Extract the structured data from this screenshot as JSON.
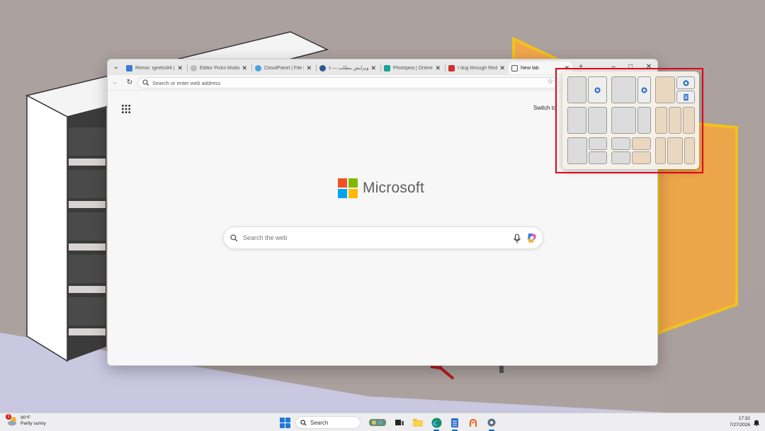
{
  "browser": {
    "tabs": [
      {
        "title": "Remix: igeeks84 | ",
        "favicon_color": "#3a7bd5",
        "active": false
      },
      {
        "title": "Editor Picks Modul",
        "favicon_color": "#999999",
        "active": false
      },
      {
        "title": "CloudPanel | File M",
        "favicon_color": "#4aa3df",
        "active": false
      },
      {
        "title": "ویرایش مطلب — ro",
        "favicon_color": "#2b5797",
        "active": false
      },
      {
        "title": "Photopea | Online I",
        "favicon_color": "#18a497",
        "active": false
      },
      {
        "title": "I dug through Redd",
        "favicon_color": "#d32f2f",
        "active": false
      },
      {
        "title": "New tab",
        "favicon_color": "#555555",
        "active": true
      }
    ],
    "address": {
      "placeholder": "Search or enter web address",
      "value": ""
    },
    "page": {
      "switch_to": "Switch to",
      "brand": "Microsoft",
      "search_placeholder": "Search the web"
    }
  },
  "snap_layouts": {
    "layouts": [
      {
        "name": "halves",
        "icons": [
          "gear-icon"
        ]
      },
      {
        "name": "two-thirds-one-third",
        "icons": [
          "gear-icon"
        ]
      },
      {
        "name": "one-and-stack",
        "icons": [
          "gear-icon",
          "notepad-icon"
        ]
      },
      {
        "name": "halves-2"
      },
      {
        "name": "large-small"
      },
      {
        "name": "three-columns"
      },
      {
        "name": "one-and-two-stacked"
      },
      {
        "name": "quadrants"
      },
      {
        "name": "wide-three-columns"
      }
    ]
  },
  "taskbar": {
    "weather": {
      "temp": "90°F",
      "condition": "Partly sunny",
      "badge": "1"
    },
    "search_label": "Search",
    "clock": {
      "time": "17:32",
      "date": "7/27/2026"
    },
    "colors": {
      "accent": "#0067c0",
      "start": "#1e7ad8"
    }
  }
}
